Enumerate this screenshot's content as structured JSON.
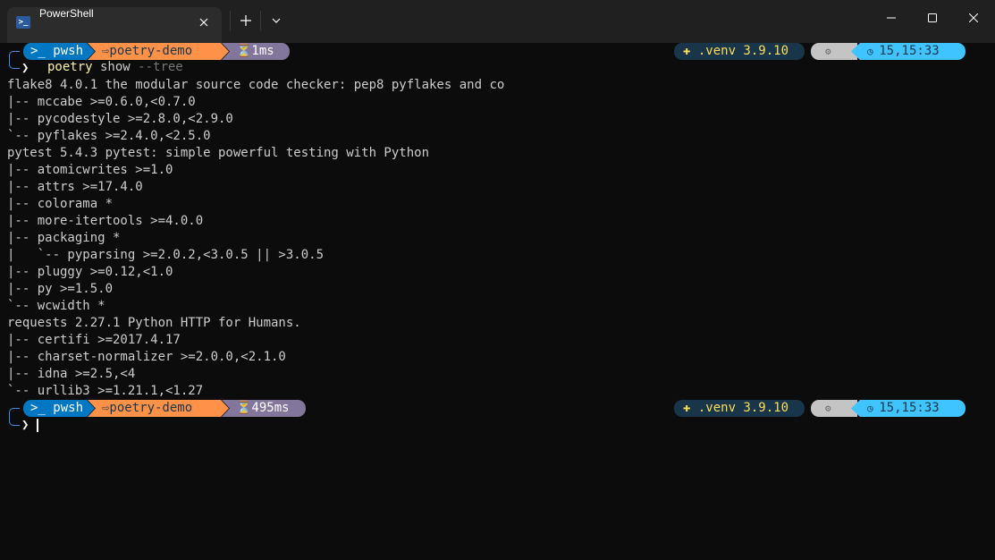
{
  "window": {
    "tab_title": "PowerShell",
    "tab_icon": "powershell-icon",
    "new_tab_symbol": "+",
    "colors": {
      "titlebar": "#202020",
      "tab": "#2c2c2c",
      "terminal_bg": "#0c0c0c",
      "text": "#cccccc"
    }
  },
  "prompt1": {
    "shell": "pwsh",
    "path": "⇨poetry-demo",
    "duration": "⏳1ms",
    "venv": ".venv 3.9.10",
    "gear": "⚙",
    "time": "15,15:33",
    "command_name": "poetry",
    "command_arg": " show",
    "command_flag": " --tree"
  },
  "output": [
    "flake8 4.0.1 the modular source code checker: pep8 pyflakes and co",
    "|-- mccabe >=0.6.0,<0.7.0",
    "|-- pycodestyle >=2.8.0,<2.9.0",
    "`-- pyflakes >=2.4.0,<2.5.0",
    "pytest 5.4.3 pytest: simple powerful testing with Python",
    "|-- atomicwrites >=1.0",
    "|-- attrs >=17.4.0",
    "|-- colorama *",
    "|-- more-itertools >=4.0.0",
    "|-- packaging *",
    "|   `-- pyparsing >=2.0.2,<3.0.5 || >3.0.5",
    "|-- pluggy >=0.12,<1.0",
    "|-- py >=1.5.0",
    "`-- wcwidth *",
    "requests 2.27.1 Python HTTP for Humans.",
    "|-- certifi >=2017.4.17",
    "|-- charset-normalizer >=2.0.0,<2.1.0",
    "|-- idna >=2.5,<4",
    "`-- urllib3 >=1.21.1,<1.27"
  ],
  "prompt2": {
    "shell": "pwsh",
    "path": "⇨poetry-demo",
    "duration": "⏳495ms",
    "venv": ".venv 3.9.10",
    "gear": "⚙",
    "time": "15,15:33"
  },
  "prompt_symbol": "❯"
}
